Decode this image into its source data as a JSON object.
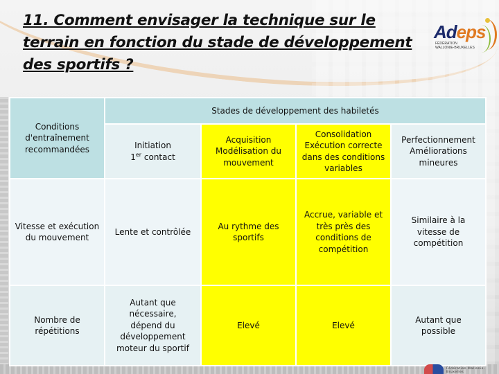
{
  "slide": {
    "title": "11. Comment envisager la technique sur le terrain en fonction du stade de développement des sportifs ?",
    "logo": {
      "brand_left": "Ad",
      "brand_right": "eps",
      "subtitle": "Fédération Wallonie-Bruxelles"
    },
    "footer_logo": {
      "text": "Fédération Wallonie-Bruxelles"
    }
  },
  "table": {
    "corner_header": "Conditions d'entraînement recommandées",
    "group_header": "Stades de développement des habiletés",
    "stages": [
      {
        "lines": [
          "Initiation",
          "1er contact"
        ],
        "highlight": false
      },
      {
        "lines": [
          "Acquisition",
          "Modélisation du",
          "mouvement"
        ],
        "highlight": true
      },
      {
        "lines": [
          "Consolidation",
          "Exécution correcte",
          "dans des conditions",
          "variables"
        ],
        "highlight": true
      },
      {
        "lines": [
          "Perfectionnement",
          "Améliorations",
          "mineures"
        ],
        "highlight": false
      }
    ],
    "rows": [
      {
        "condition": "Vitesse et exécution du mouvement",
        "cells": [
          "Lente et contrôlée",
          "Au rythme des sportifs",
          "Accrue, variable et très près des conditions de compétition",
          "Similaire à la vitesse de compétition"
        ]
      },
      {
        "condition": "Nombre de répétitions",
        "cells": [
          "Autant que nécessaire, dépend du développement moteur du sportif",
          "Elevé",
          "Elevé",
          "Autant que possible"
        ]
      }
    ]
  },
  "colors": {
    "header_bg": "#bde0e3",
    "cell_light": "#e6f1f3",
    "cell_lighter": "#eef5f8",
    "highlight": "#ffff00",
    "brand_blue": "#1c2a6b",
    "brand_orange": "#e07a22"
  }
}
